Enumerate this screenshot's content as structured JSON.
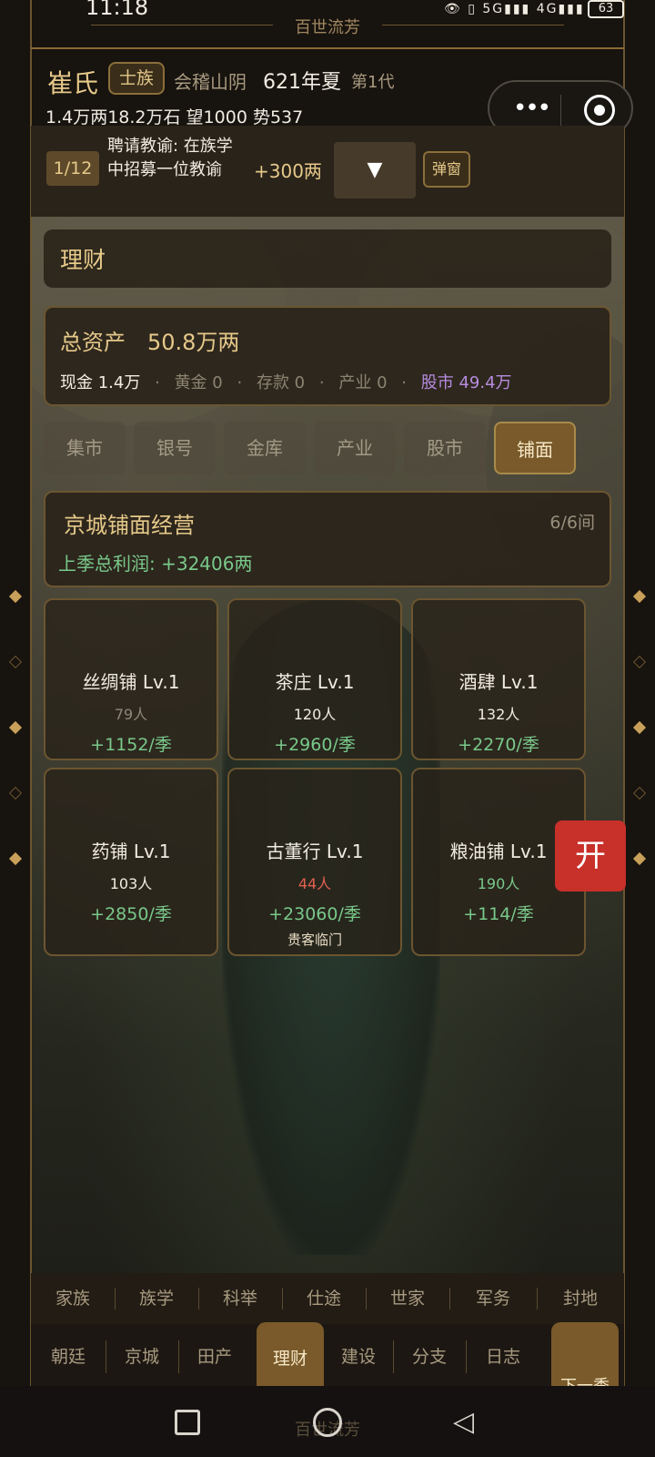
{
  "status_bar": {
    "time": "11:18",
    "icons": "👁 ▯ 5G▮▮▮ 4G▮▮▮",
    "battery": "63"
  },
  "header": {
    "title": "百世流芳"
  },
  "clan": {
    "name": "崔氏",
    "rank": "士族",
    "place": "会稽山阴",
    "year": "621年夏",
    "generation": "第1代",
    "stats": "1.4万两18.2万石  望1000  势537"
  },
  "task": {
    "counter": "1/12",
    "text": "聘请教谕: 在族学中招募一位教谕",
    "reward": "+300两",
    "dropdown": "▼",
    "popup_label": "弹窗"
  },
  "section": {
    "title": "理财"
  },
  "assets": {
    "total_label": "总资产",
    "total_value": "50.8万两",
    "cash": "现金 1.4万",
    "gold": "黄金 0",
    "deposit": "存款 0",
    "property": "产业 0",
    "stocks": "股市 49.4万",
    "separator": "·"
  },
  "tabs": [
    "集市",
    "银号",
    "金库",
    "产业",
    "股市",
    "铺面"
  ],
  "active_tab": "铺面",
  "shops_header": {
    "title": "京城铺面经营",
    "count": "6/6间",
    "profit": "上季总利润: +32406两"
  },
  "shops": [
    {
      "name": "丝绸铺 Lv.1",
      "people": "79人",
      "people_color": "gray",
      "income": "+1152/季",
      "note": ""
    },
    {
      "name": "茶庄 Lv.1",
      "people": "120人",
      "people_color": "white",
      "income": "+2960/季",
      "note": ""
    },
    {
      "name": "酒肆 Lv.1",
      "people": "132人",
      "people_color": "white",
      "income": "+2270/季",
      "note": ""
    },
    {
      "name": "药铺 Lv.1",
      "people": "103人",
      "people_color": "white",
      "income": "+2850/季",
      "note": ""
    },
    {
      "name": "古董行 Lv.1",
      "people": "44人",
      "people_color": "red",
      "income": "+23060/季",
      "note": "贵客临门"
    },
    {
      "name": "粮油铺 Lv.1",
      "people": "190人",
      "people_color": "green",
      "income": "+114/季",
      "note": ""
    }
  ],
  "open_button": "开",
  "nav_top": [
    "家族",
    "族学",
    "科举",
    "仕途",
    "世家",
    "军务",
    "封地"
  ],
  "nav_bottom": [
    "朝廷",
    "京城",
    "田产",
    "理财",
    "建设",
    "分支",
    "日志"
  ],
  "next_season": "下一季",
  "footer": {
    "title": "百世流芳"
  },
  "colors": {
    "accent_gold": "#e6c98a",
    "positive": "#79c88a",
    "negative": "#e06050",
    "stock_purple": "#b68ce0",
    "open_red": "#c8302a"
  }
}
